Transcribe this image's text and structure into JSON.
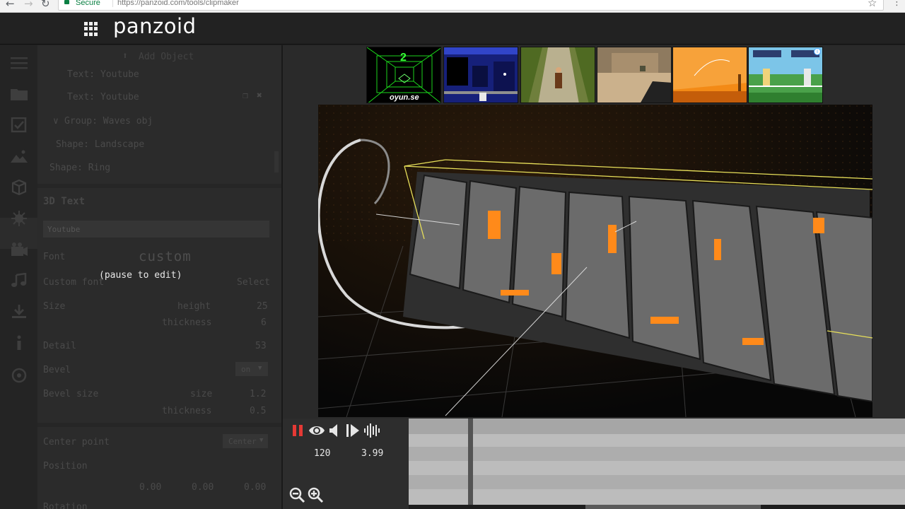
{
  "browser": {
    "secure_label": "Secure",
    "url": "https://panzoid.com/tools/clipmaker"
  },
  "header": {
    "logo": "panzoid"
  },
  "sidebar": {
    "icons": [
      "menu-icon",
      "folder-icon",
      "checkbox-icon",
      "image-icon",
      "3d-icon",
      "particles-icon",
      "video-icon",
      "music-icon",
      "download-icon",
      "info-icon",
      "settings-icon"
    ]
  },
  "panel": {
    "add_object_label": "Add Object",
    "tree": [
      "Text: Youtube",
      "Text: Youtube",
      "Group: Waves obj",
      "Shape: Landscape",
      "Shape: Ring"
    ],
    "section_title": "3D Text",
    "text_value": "Youtube",
    "font_label": "Font",
    "font_value": "custom",
    "custom_font_label": "Custom font",
    "custom_font_button": "Select",
    "size_label": "Size",
    "height_label": "height",
    "height_value": "25",
    "thickness_label": "thickness",
    "thickness_value": "6",
    "detail_label": "Detail",
    "detail_value": "53",
    "bevel_label": "Bevel",
    "bevel_value": "on",
    "bevel_size_label": "Bevel size",
    "bevel_size_sub": "size",
    "bevel_size_value": "1.2",
    "bevel_thickness_label": "thickness",
    "bevel_thickness_value": "0.5",
    "center_label": "Center point",
    "center_value": "Center",
    "position_label": "Position",
    "pos_x": "0.00",
    "pos_y": "0.00",
    "pos_z": "0.00",
    "rotation_label": "Rotation",
    "pause_note": "(pause to edit)"
  },
  "ads": {
    "items": [
      {
        "name": "ad-tunnel-game",
        "caption": "oyun.se",
        "number": "2"
      },
      {
        "name": "ad-platform-game"
      },
      {
        "name": "ad-temple-run"
      },
      {
        "name": "ad-shooter-game"
      },
      {
        "name": "ad-orange-game"
      },
      {
        "name": "ad-soccer-game"
      }
    ]
  },
  "transport": {
    "fps": "120",
    "time": "3.99"
  },
  "colors": {
    "accent_red": "#e53935",
    "wireframe_yellow": "#e8e05a",
    "text_orange": "#ff8a1a"
  }
}
